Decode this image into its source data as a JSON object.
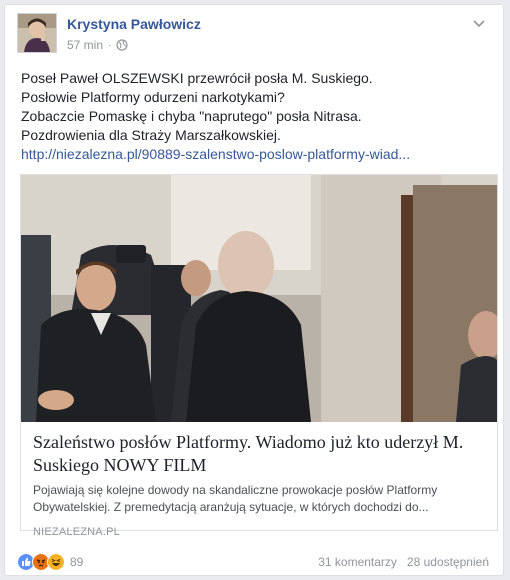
{
  "post": {
    "author": "Krystyna Pawłowicz",
    "time": "57 min",
    "dot": "·",
    "privacy_icon": "globe-icon",
    "menu_icon": "chevron-down-icon"
  },
  "message": {
    "lines": [
      "Poseł Paweł OLSZEWSKI przewrócił posła M. Suskiego.",
      "Posłowie Platformy odurzeni narkotykami?",
      "Zobaczcie Pomaskę i chyba \"naprutego\" posła Nitrasa.",
      "Pozdrowienia dla Straży Marszałkowskiej."
    ],
    "link": "http://niezalezna.pl/90889-szalenstwo-poslow-platformy-wiad..."
  },
  "link_preview": {
    "title": "Szaleństwo posłów Platformy. Wiadomo już kto uderzył M. Suskiego NOWY FILM",
    "description": "Pojawiają się kolejne dowody na skandaliczne prowokacje posłów Platformy Obywatelskiej. Z premedytacją aranżują sytuacje, w których dochodzi do...",
    "domain": "NIEZALEZNA.PL"
  },
  "footer": {
    "reactions": [
      "like",
      "angry",
      "haha"
    ],
    "reaction_count": "89",
    "comments": "31 komentarzy",
    "shares": "28 udostępnień"
  },
  "colors": {
    "link": "#365899",
    "like": "#5890ff",
    "angry": "#e9710f",
    "haha": "#f7b125"
  }
}
